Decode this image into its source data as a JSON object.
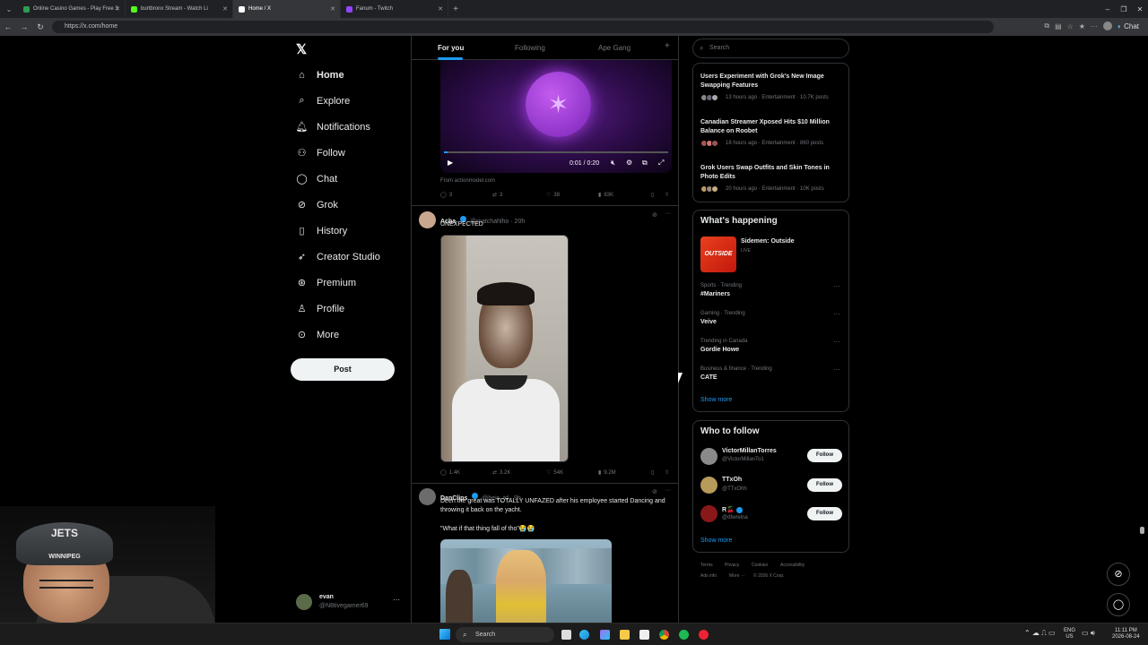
{
  "browser": {
    "tabs": [
      {
        "title": "Online Casino Games - Play Free 3",
        "fav": "#2e9e4f"
      },
      {
        "title": "burtbronx Stream - Watch Li",
        "fav": "#53fc18"
      },
      {
        "title": "Home / X",
        "fav": "#ffffff"
      },
      {
        "title": "Fanum - Twitch",
        "fav": "#9146ff"
      }
    ],
    "url": "https://x.com/home",
    "chat_label": "Chat"
  },
  "nav": {
    "items": [
      {
        "label": "Home",
        "icon": "home-icon"
      },
      {
        "label": "Explore",
        "icon": "search-icon"
      },
      {
        "label": "Notifications",
        "icon": "bell-icon"
      },
      {
        "label": "Follow",
        "icon": "person-add-icon"
      },
      {
        "label": "Chat",
        "icon": "chat-icon"
      },
      {
        "label": "Grok",
        "icon": "grok-icon"
      },
      {
        "label": "History",
        "icon": "bookmark-icon"
      },
      {
        "label": "Creator Studio",
        "icon": "rocket-icon"
      },
      {
        "label": "Premium",
        "icon": "verified-icon"
      },
      {
        "label": "Profile",
        "icon": "person-icon"
      },
      {
        "label": "More",
        "icon": "more-icon"
      }
    ],
    "post_label": "Post",
    "account": {
      "name": "evan",
      "handle": "@N8tivegamer69"
    }
  },
  "feed": {
    "tabs": [
      "For you",
      "Following",
      "Ape Gang"
    ],
    "add": "+",
    "video1": {
      "time": "0:01 / 0:20",
      "source": "From actionmodel.com",
      "replies": "3",
      "reposts": "3",
      "likes": "38",
      "views": "83K"
    },
    "tweet1": {
      "name": "Acha",
      "handle": "@matchahlho · 20h",
      "text": "UNEXPECTED",
      "replies": "1.4K",
      "reposts": "3.2K",
      "likes": "54K",
      "views": "9.2M"
    },
    "tweet2": {
      "name": "DanClips",
      "handle": "@heis_td · 9h",
      "text": "Deen the great was TOTALLY UNFAZED after his employee started Dancing and throwing it back on the yacht.",
      "quote": "\"What if that thing fall of tho\"😭😭"
    }
  },
  "right": {
    "search_placeholder": "Search",
    "news": [
      {
        "title": "Users Experiment with Grok's New Image Swapping Features",
        "meta": "13 hours ago · Entertainment · 10.7K posts"
      },
      {
        "title": "Canadian Streamer Xposed Hits $10 Million Balance on Roobet",
        "meta": "18 hours ago · Entertainment · 860 posts"
      },
      {
        "title": "Grok Users Swap Outfits and Skin Tones in Photo Edits",
        "meta": "20 hours ago · Entertainment · 10K posts"
      }
    ],
    "happening_title": "What's happening",
    "live": {
      "title": "Sidemen: Outside",
      "status": "LIVE",
      "thumb": "OUTSIDE"
    },
    "trends": [
      {
        "meta": "Sports · Trending",
        "name": "#Mariners"
      },
      {
        "meta": "Gaming · Trending",
        "name": "Veive"
      },
      {
        "meta": "Trending in Canada",
        "name": "Gordie Howe"
      },
      {
        "meta": "Business & finance · Trending",
        "name": "CATE"
      }
    ],
    "show_more": "Show more",
    "who_title": "Who to follow",
    "follow": [
      {
        "name": "VictorMillanTorres",
        "handle": "@VictorMillanTo1"
      },
      {
        "name": "TTxOh",
        "handle": "@TTxOhh"
      },
      {
        "name": "R🍒",
        "handle": "@dfwrelna"
      }
    ],
    "follow_label": "Follow",
    "footer": [
      "Terms",
      "Privacy",
      "Cookies",
      "Accessibility",
      "Ads info",
      "More ···",
      "© 2026 X Corp."
    ]
  },
  "webcam": {
    "cap_text": "JETS",
    "cap_sub": "WINNIPEG"
  },
  "taskbar": {
    "search": "Search",
    "lang": "ENG",
    "region": "US",
    "time": "11:11 PM",
    "date": "2026-08-24"
  }
}
